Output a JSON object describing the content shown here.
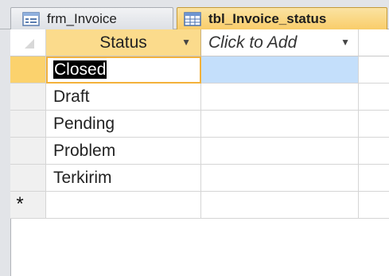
{
  "tabs": [
    {
      "label": "frm_Invoice",
      "icon": "form-icon",
      "active": false
    },
    {
      "label": "tbl_Invoice_status",
      "icon": "table-icon",
      "active": true
    }
  ],
  "table": {
    "columns": [
      {
        "label": "Status",
        "has_dropdown": true
      },
      {
        "label": "Click to Add",
        "has_dropdown": true
      }
    ],
    "rows": [
      {
        "status": "Closed",
        "current": true
      },
      {
        "status": "Draft"
      },
      {
        "status": "Pending"
      },
      {
        "status": "Problem"
      },
      {
        "status": "Terkirim"
      }
    ],
    "new_record_marker": "*"
  },
  "colors": {
    "active_tab": "#f9cd6a",
    "selected_header": "#fbdb8c",
    "current_row_highlight": "#c4dffb",
    "focus_border": "#f3b13a"
  }
}
